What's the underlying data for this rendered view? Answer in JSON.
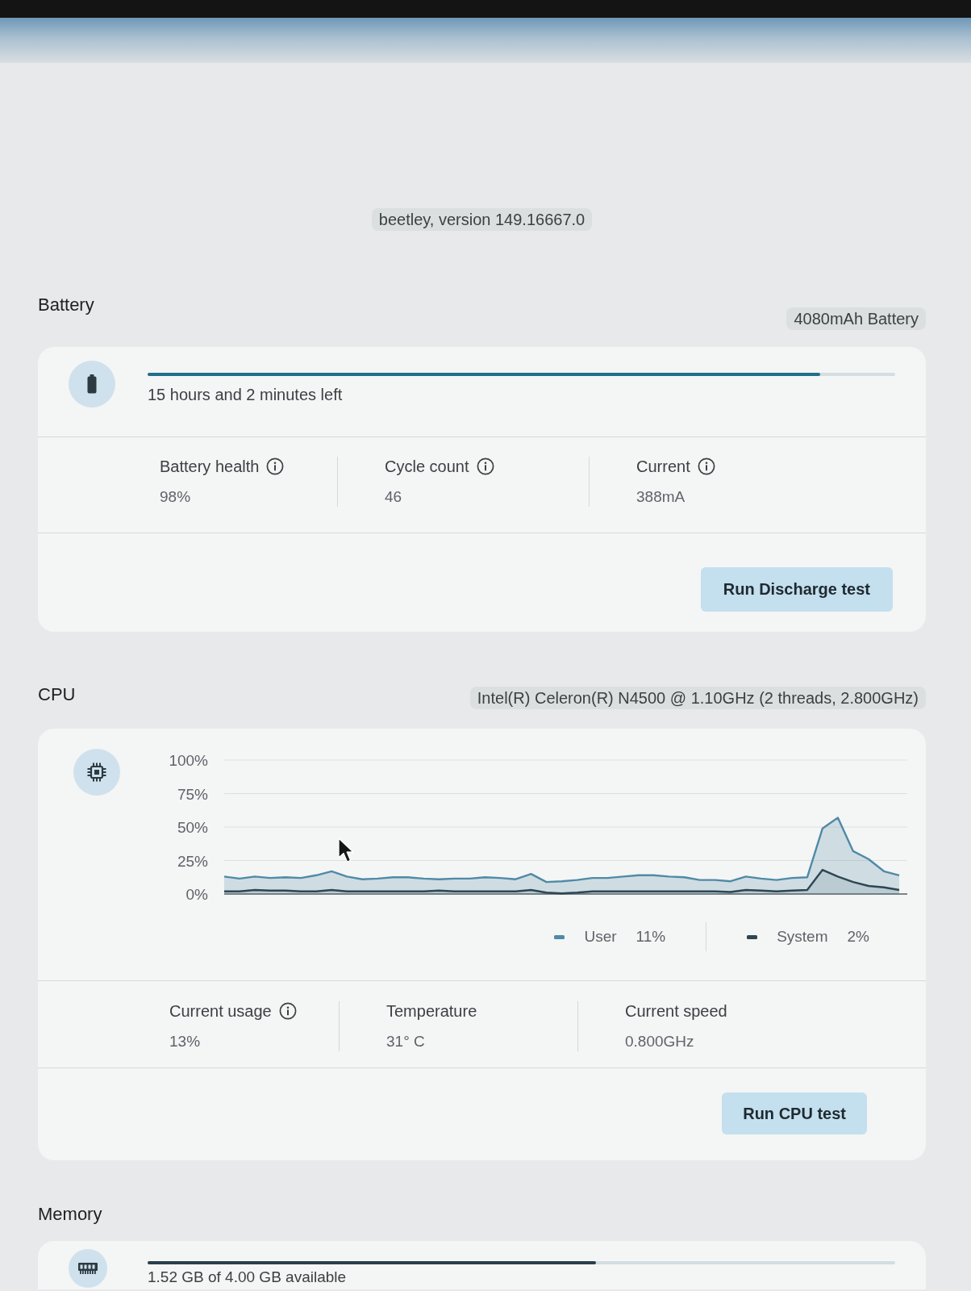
{
  "window": {
    "version_label": "beetley, version 149.16667.0"
  },
  "battery": {
    "title": "Battery",
    "capacity": "4080mAh Battery",
    "level": 0.9,
    "status": "15 hours and 2 minutes left",
    "metrics": [
      {
        "label": "Battery health",
        "info": true,
        "value": "98%"
      },
      {
        "label": "Cycle count",
        "info": true,
        "value": "46"
      },
      {
        "label": "Current",
        "info": true,
        "value": "388mA"
      }
    ],
    "button": "Run Discharge test"
  },
  "cpu": {
    "title": "CPU",
    "model": "Intel(R) Celeron(R) N4500 @ 1.10GHz (2 threads, 2.800GHz)",
    "chart_data": {
      "type": "area",
      "grid": true,
      "ylim": [
        0,
        100
      ],
      "yticks": [
        {
          "value": 100,
          "label": "100%"
        },
        {
          "value": 75,
          "label": "75%"
        },
        {
          "value": 50,
          "label": "50%"
        },
        {
          "value": 25,
          "label": "25%"
        },
        {
          "value": 0,
          "label": "0%"
        }
      ],
      "series": [
        {
          "name": "User",
          "color": "#4f8aa6",
          "values": [
            13,
            11.5,
            13,
            12,
            12.5,
            12,
            14,
            17,
            13,
            11,
            11.5,
            12.5,
            12.5,
            11.5,
            11,
            11.5,
            11.5,
            12.5,
            12,
            11,
            15,
            9,
            9.5,
            10.5,
            12,
            12,
            13,
            14,
            14,
            13,
            12.5,
            10.5,
            10.5,
            9.5,
            13,
            11.5,
            10.5,
            12,
            12.5,
            49,
            57,
            32,
            26,
            17,
            14
          ]
        },
        {
          "name": "System",
          "color": "#2d4654",
          "values": [
            2,
            2,
            3,
            2.5,
            2.5,
            2,
            2,
            3,
            2,
            2,
            2,
            2,
            2,
            2,
            2.5,
            2,
            2,
            2,
            2,
            2,
            3,
            1,
            0.5,
            1,
            2,
            2,
            2,
            2,
            2,
            2,
            2,
            2,
            2,
            1.5,
            3,
            2.5,
            2,
            2.5,
            3,
            18,
            13,
            9,
            6,
            5,
            3
          ]
        }
      ]
    },
    "legend_readings": [
      "11%",
      "2%"
    ],
    "metrics": [
      {
        "label": "Current usage",
        "info": true,
        "value": "13%"
      },
      {
        "label": "Temperature",
        "info": false,
        "value": "31° C"
      },
      {
        "label": "Current speed",
        "info": false,
        "value": "0.800GHz"
      }
    ],
    "button": "Run CPU test"
  },
  "memory": {
    "title": "Memory",
    "level": 0.6,
    "status": "1.52 GB of 4.00 GB available"
  }
}
